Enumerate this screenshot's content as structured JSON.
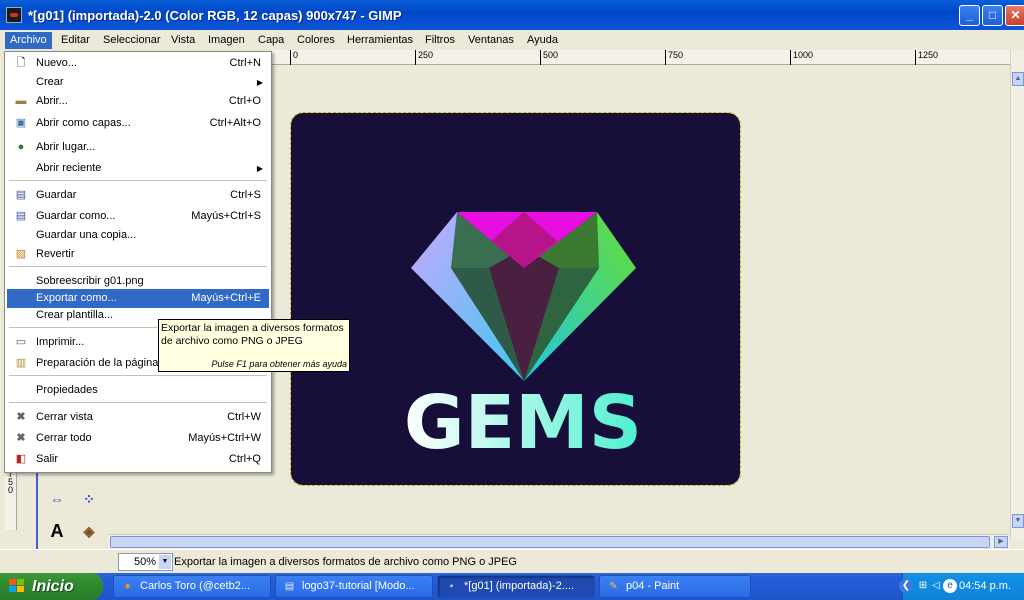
{
  "window": {
    "title": "*[g01] (importada)-2.0 (Color RGB, 12 capas) 900x747 - GIMP",
    "minimize": "_",
    "maximize": "□",
    "close": "✕"
  },
  "menubar": {
    "items": [
      "Archivo",
      "Editar",
      "Seleccionar",
      "Vista",
      "Imagen",
      "Capa",
      "Colores",
      "Herramientas",
      "Filtros",
      "Ventanas",
      "Ayuda"
    ],
    "active": "Archivo"
  },
  "file_menu": {
    "items": [
      {
        "label": "Nuevo...",
        "accel": "Ctrl+N",
        "icon": "new-document-icon"
      },
      {
        "label": "Crear",
        "accel": "",
        "submenu": true
      },
      {
        "label": "Abrir...",
        "accel": "Ctrl+O",
        "icon": "open-folder-icon"
      },
      {
        "label": "Abrir como capas...",
        "accel": "Ctrl+Alt+O",
        "icon": "open-as-layers-icon"
      },
      {
        "label": "Abrir lugar...",
        "accel": "",
        "icon": "globe-icon"
      },
      {
        "label": "Abrir reciente",
        "accel": "",
        "submenu": true
      },
      {
        "label": "Guardar",
        "accel": "Ctrl+S",
        "icon": "save-icon"
      },
      {
        "label": "Guardar como...",
        "accel": "Mayús+Ctrl+S",
        "icon": "save-as-icon"
      },
      {
        "label": "Guardar una copia...",
        "accel": ""
      },
      {
        "label": "Revertir",
        "accel": "",
        "icon": "revert-icon"
      },
      {
        "label": "Sobreescribir g01.png",
        "accel": ""
      },
      {
        "label": "Exportar como...",
        "accel": "Mayús+Ctrl+E"
      },
      {
        "label": "Crear plantilla...",
        "accel": ""
      },
      {
        "label": "Imprimir...",
        "accel": "",
        "icon": "printer-icon"
      },
      {
        "label": "Preparación de la página",
        "accel": "",
        "icon": "page-setup-icon"
      },
      {
        "label": "Propiedades",
        "accel": ""
      },
      {
        "label": "Cerrar vista",
        "accel": "Ctrl+W",
        "icon": "close-x-icon"
      },
      {
        "label": "Cerrar todo",
        "accel": "Mayús+Ctrl+W",
        "icon": "close-x-icon"
      },
      {
        "label": "Salir",
        "accel": "Ctrl+Q",
        "icon": "quit-icon"
      }
    ],
    "highlighted": "Exportar como..."
  },
  "tooltip": {
    "line1": "Exportar la imagen a diversos formatos",
    "line2": "de archivo como PNG o JPEG",
    "hint": "Pulse F1 para obtener más ayuda"
  },
  "ruler": {
    "ticks": [
      "0",
      "250",
      "500",
      "750",
      "1000",
      "1250"
    ],
    "vertical_label": "7 5 0"
  },
  "image": {
    "logo_text": "GEMS",
    "background_color": "#170f3a"
  },
  "statusbar": {
    "zoom": "50%",
    "message": "Exportar la imagen a diversos formatos de archivo como PNG o JPEG"
  },
  "taskbar": {
    "start_label": "Inicio",
    "tasks": [
      {
        "label": "Carlos Toro (@cetb2...",
        "icon": "firefox-icon"
      },
      {
        "label": "logo37-tutorial [Modo...",
        "icon": "word-document-icon"
      },
      {
        "label": "*[g01] (importada)-2....",
        "icon": "gimp-icon",
        "active": true
      },
      {
        "label": "p04 - Paint",
        "icon": "paint-icon"
      }
    ],
    "clock": "04:54 p.m."
  },
  "colors": {
    "accent": "#316ac5",
    "titlebar": "#0048c8",
    "diamond_top": "#e60fe0",
    "diamond_left": "#7fc8f8",
    "diamond_right": "#66dd33",
    "text_gradient_start": "#ffffff",
    "text_gradient_end": "#4ef0d0"
  }
}
